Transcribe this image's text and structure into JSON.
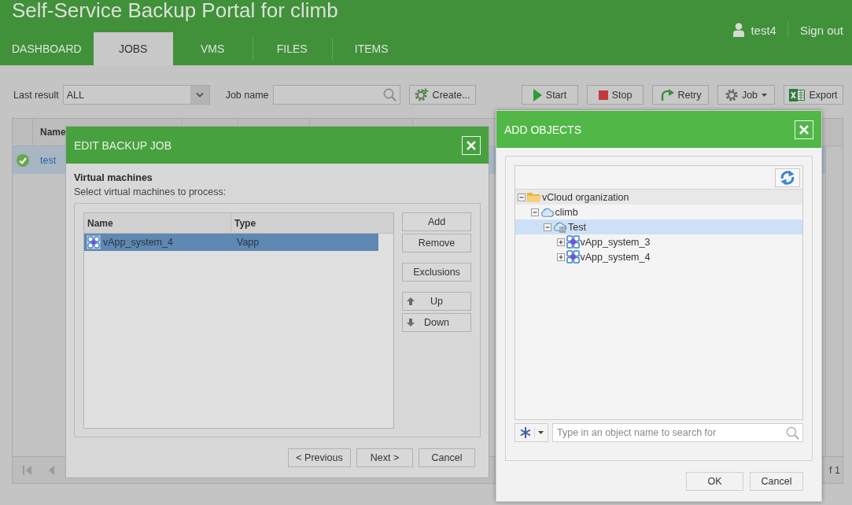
{
  "header": {
    "title": "Self-Service Backup Portal for climb",
    "user": "test4",
    "sign_out": "Sign out"
  },
  "tabs": [
    {
      "label": "DASHBOARD",
      "selected": false
    },
    {
      "label": "JOBS",
      "selected": true
    },
    {
      "label": "VMS",
      "selected": false
    },
    {
      "label": "FILES",
      "selected": false
    },
    {
      "label": "ITEMS",
      "selected": false
    }
  ],
  "toolbar": {
    "last_result_label": "Last result",
    "last_result_value": "ALL",
    "job_name_label": "Job name",
    "create_button": "Create...",
    "actions": [
      {
        "kind": "start",
        "label": "Start"
      },
      {
        "kind": "stop",
        "label": "Stop"
      },
      {
        "kind": "retry",
        "label": "Retry"
      },
      {
        "kind": "job",
        "label": "Job"
      },
      {
        "kind": "export",
        "label": "Export"
      }
    ]
  },
  "jobs_table": {
    "columns": [
      "Name"
    ],
    "rows": [
      {
        "succeeded": true,
        "name": "test",
        "selected": true
      }
    ],
    "pager_text": "f 1"
  },
  "edit_dialog": {
    "title": "EDIT BACKUP JOB",
    "section_title": "Virtual machines",
    "section_hint": "Select virtual machines to process:",
    "columns": [
      "Name",
      "Type"
    ],
    "rows": [
      {
        "name": "vApp_system_4",
        "type": "Vapp",
        "selected": true
      }
    ],
    "side_buttons": [
      [
        {
          "kind": "plain",
          "label": "Add"
        },
        {
          "kind": "plain",
          "label": "Remove"
        }
      ],
      [
        {
          "kind": "plain",
          "label": "Exclusions"
        }
      ],
      [
        {
          "kind": "up",
          "label": "Up"
        },
        {
          "kind": "down",
          "label": "Down"
        }
      ]
    ],
    "footer_buttons": [
      "< Previous",
      "Next >",
      "Cancel"
    ]
  },
  "add_dialog": {
    "title": "ADD OBJECTS",
    "tree": [
      {
        "kind": "folder",
        "label": "vCloud organization",
        "expanded": true,
        "selected": false,
        "hovered": true,
        "children": [
          {
            "kind": "cloud",
            "label": "climb",
            "expanded": true,
            "selected": false,
            "hovered": false,
            "children": [
              {
                "kind": "datacenter",
                "label": "Test",
                "expanded": true,
                "selected": true,
                "hovered": false,
                "children": [
                  {
                    "kind": "vapp",
                    "label": "vApp_system_3",
                    "expanded": false,
                    "selected": false,
                    "hovered": false
                  },
                  {
                    "kind": "vapp",
                    "label": "vApp_system_4",
                    "expanded": false,
                    "selected": false,
                    "hovered": false
                  }
                ]
              }
            ]
          }
        ]
      }
    ],
    "search_placeholder": "Type in an object name to search for",
    "footer_buttons": [
      "OK",
      "Cancel"
    ]
  }
}
